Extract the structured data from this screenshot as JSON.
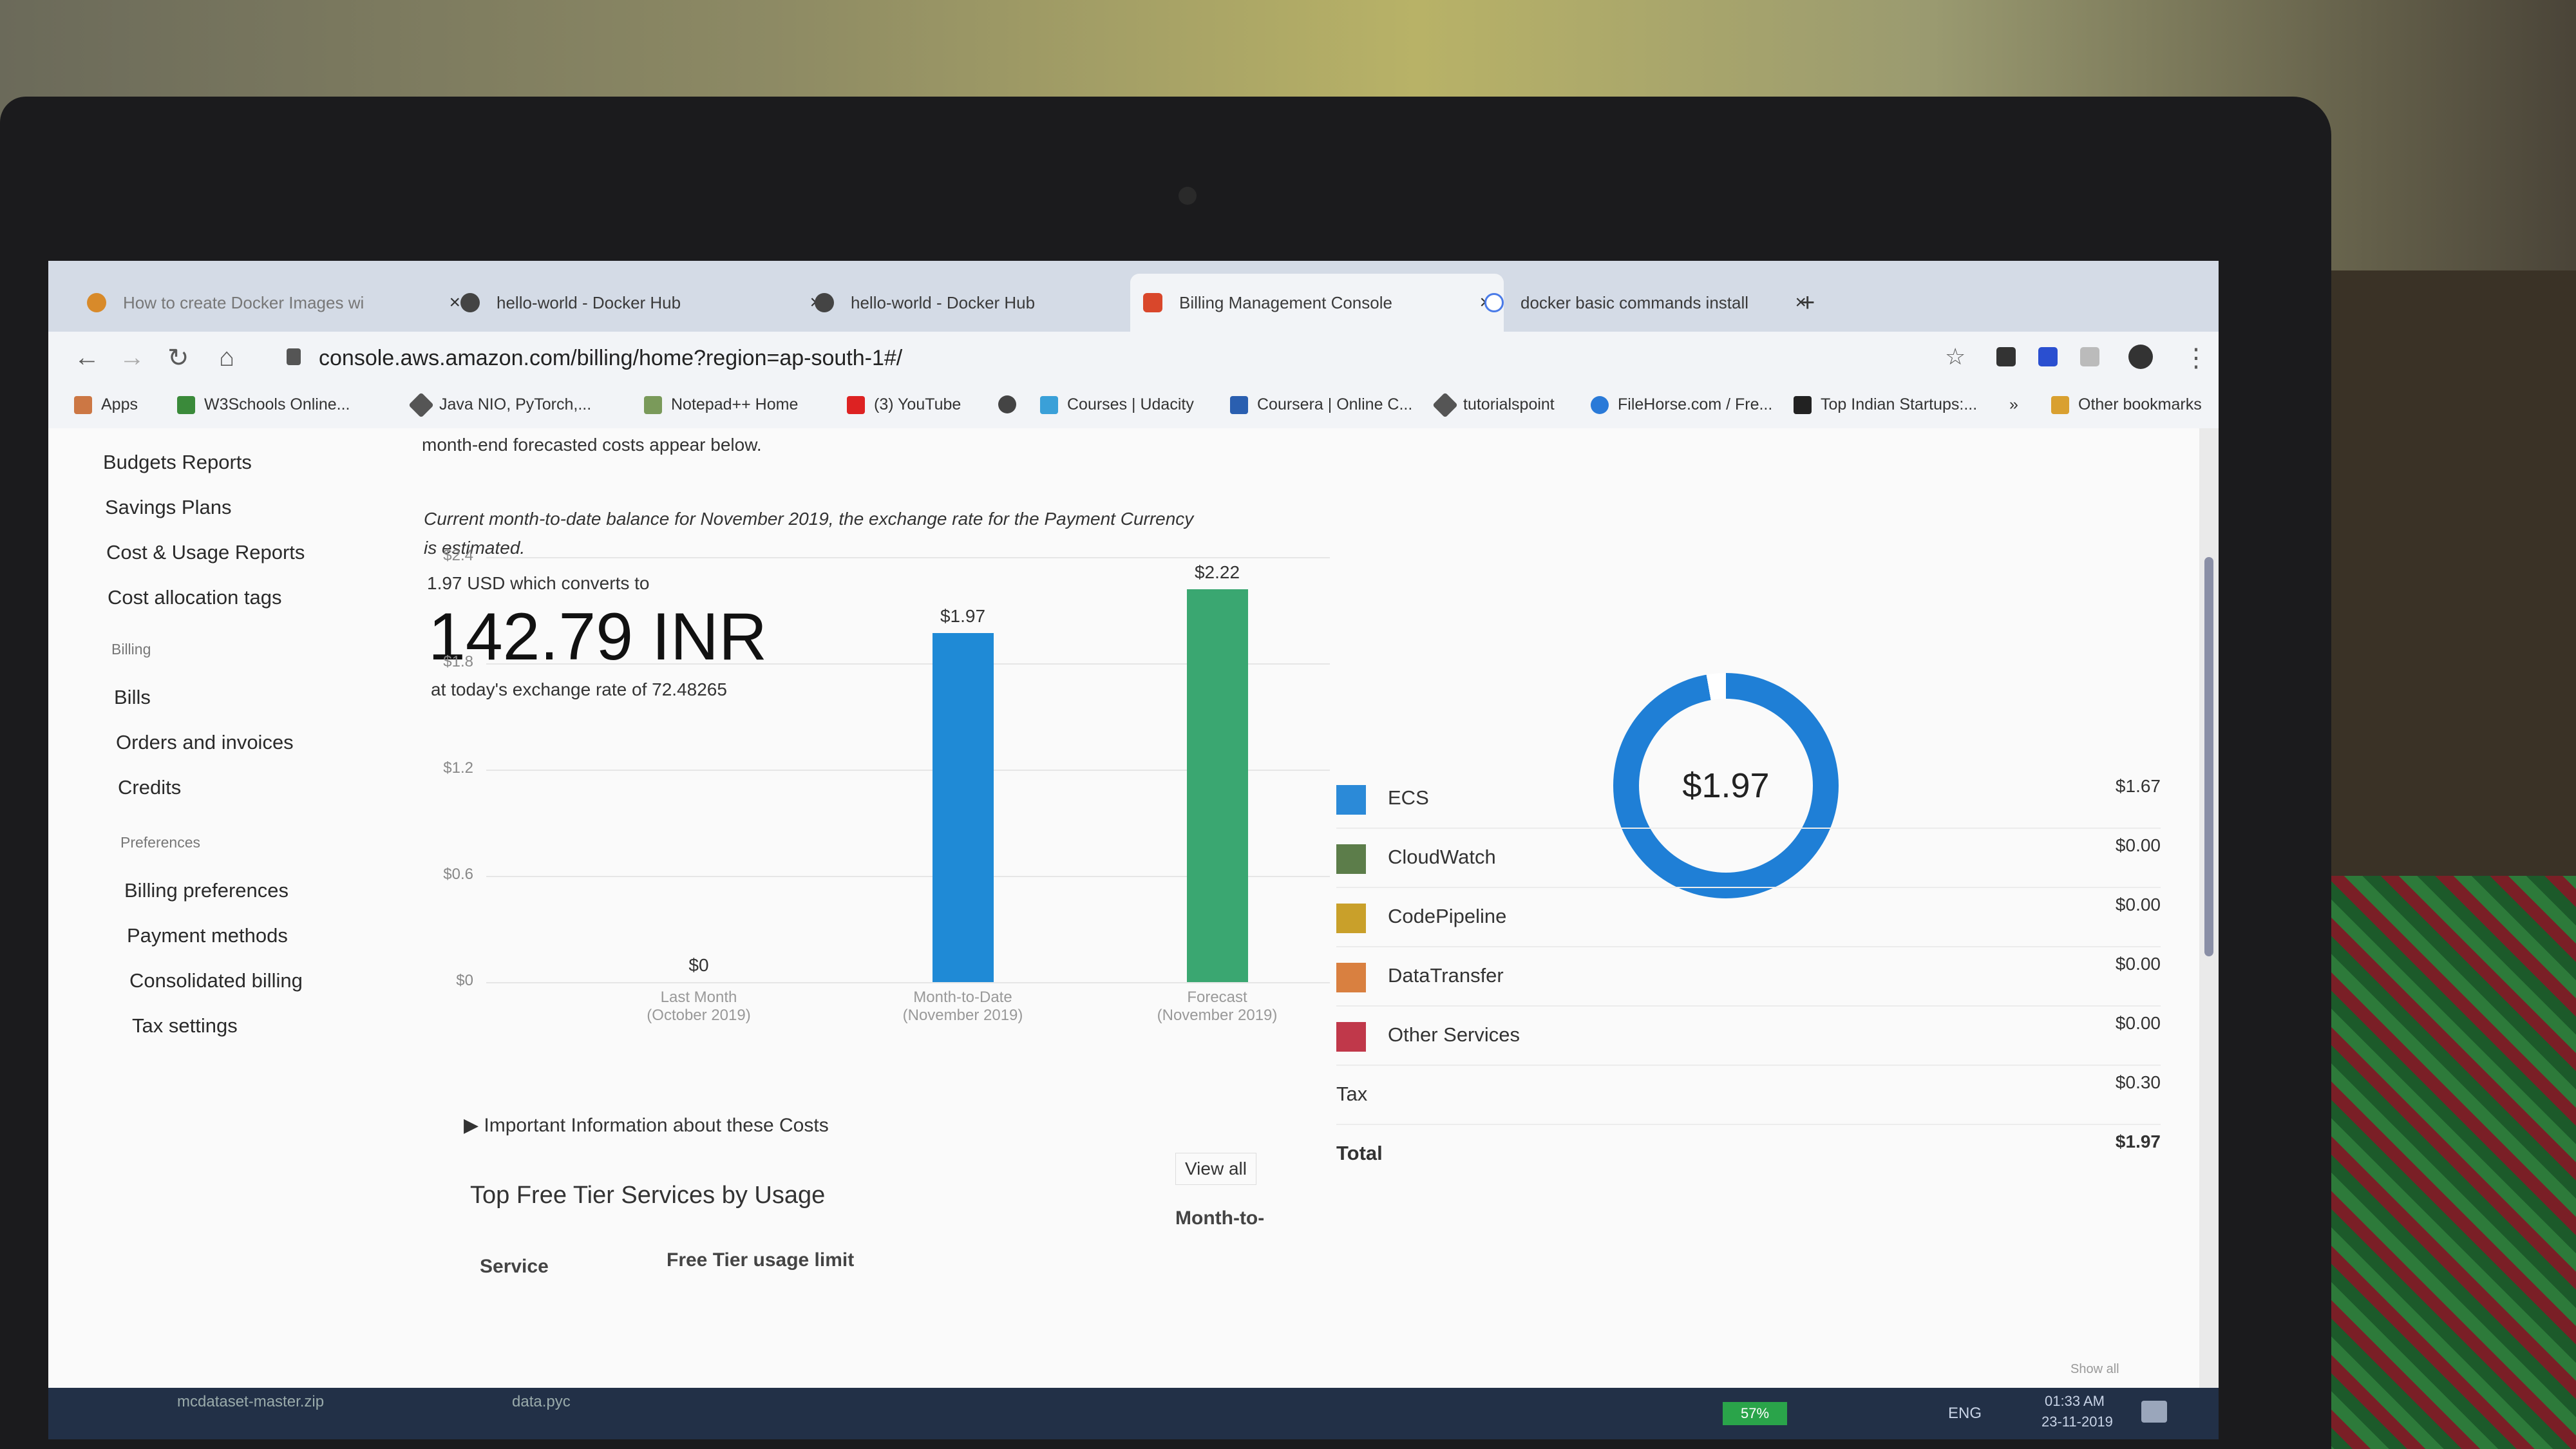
{
  "browser": {
    "tabs": [
      {
        "label": "How to create Docker Images wi"
      },
      {
        "label": "hello-world - Docker Hub"
      },
      {
        "label": "hello-world - Docker Hub"
      },
      {
        "label": "Billing Management Console"
      },
      {
        "label": "docker basic commands install"
      }
    ],
    "new_tab_label": "+",
    "close_glyph": "×",
    "url": "console.aws.amazon.com/billing/home?region=ap-south-1#/",
    "bookmarks": [
      "Apps",
      "W3Schools Online...",
      "Java NIO, PyTorch,...",
      "Notepad++ Home",
      "(3) YouTube",
      "Courses | Udacity",
      "Coursera | Online C...",
      "tutorialspoint",
      "FileHorse.com / Fre...",
      "Top Indian Startups:..."
    ],
    "more_bookmarks": "»",
    "other_bookmarks": "Other bookmarks"
  },
  "sidebar": {
    "items_top": [
      "Budgets Reports",
      "Savings Plans",
      "Cost & Usage Reports",
      "Cost allocation tags"
    ],
    "billing_heading": "Billing",
    "billing_items": [
      "Bills",
      "Orders and invoices",
      "Credits"
    ],
    "preferences_heading": "Preferences",
    "preferences_items": [
      "Billing preferences",
      "Payment methods",
      "Consolidated billing",
      "Tax settings"
    ]
  },
  "summary": {
    "intro_tail": "month-end forecasted costs appear below.",
    "note": "Current month-to-date balance for November 2019, the exchange rate for the Payment Currency",
    "note2": "is estimated.",
    "usd_line": "1.97 USD which converts to",
    "inr_amount": "142.79 INR",
    "rate_line": "at today's exchange rate of 72.48265"
  },
  "chart_data": {
    "type": "bar",
    "categories": [
      "Last Month (October 2019)",
      "Month-to-Date (November 2019)",
      "Forecast (November 2019)"
    ],
    "category_lines": [
      [
        "Last Month",
        "(October 2019)"
      ],
      [
        "Month-to-Date",
        "(November 2019)"
      ],
      [
        "Forecast",
        "(November 2019)"
      ]
    ],
    "values": [
      0,
      1.97,
      2.22
    ],
    "data_labels": [
      "$0",
      "$1.97",
      "$2.22"
    ],
    "bar_colors": [
      "#1f8ad6",
      "#1f8ad6",
      "#3aa771"
    ],
    "yticks": [
      "$0",
      "$0.6",
      "$1.2",
      "$1.8",
      "$2.4"
    ],
    "ylim": [
      0,
      2.4
    ]
  },
  "important_info": "Important Information about these Costs",
  "free_tier": {
    "title": "Top Free Tier Services by Usage",
    "view_all": "View all",
    "columns": [
      "Service",
      "Free Tier usage limit",
      "Month-to-"
    ]
  },
  "donut": {
    "center_label": "$1.97",
    "color": "#1f7fd6"
  },
  "services": [
    {
      "name": "ECS",
      "value": "$1.67",
      "color": "#2b8ad8"
    },
    {
      "name": "CloudWatch",
      "value": "$0.00",
      "color": "#5c7d4a"
    },
    {
      "name": "CodePipeline",
      "value": "$0.00",
      "color": "#c9a02a"
    },
    {
      "name": "DataTransfer",
      "value": "$0.00",
      "color": "#d98040"
    },
    {
      "name": "Other Services",
      "value": "$0.00",
      "color": "#c0384a"
    }
  ],
  "tax": {
    "label": "Tax",
    "value": "$0.30"
  },
  "total": {
    "label": "Total",
    "value": "$1.97"
  },
  "taskbar": {
    "download": "mcdataset-master.zip",
    "download2": "data.pyc",
    "battery": "57%",
    "lang": "ENG",
    "time": "01:33 AM",
    "date": "23-11-2019",
    "show_all": "Show all"
  }
}
